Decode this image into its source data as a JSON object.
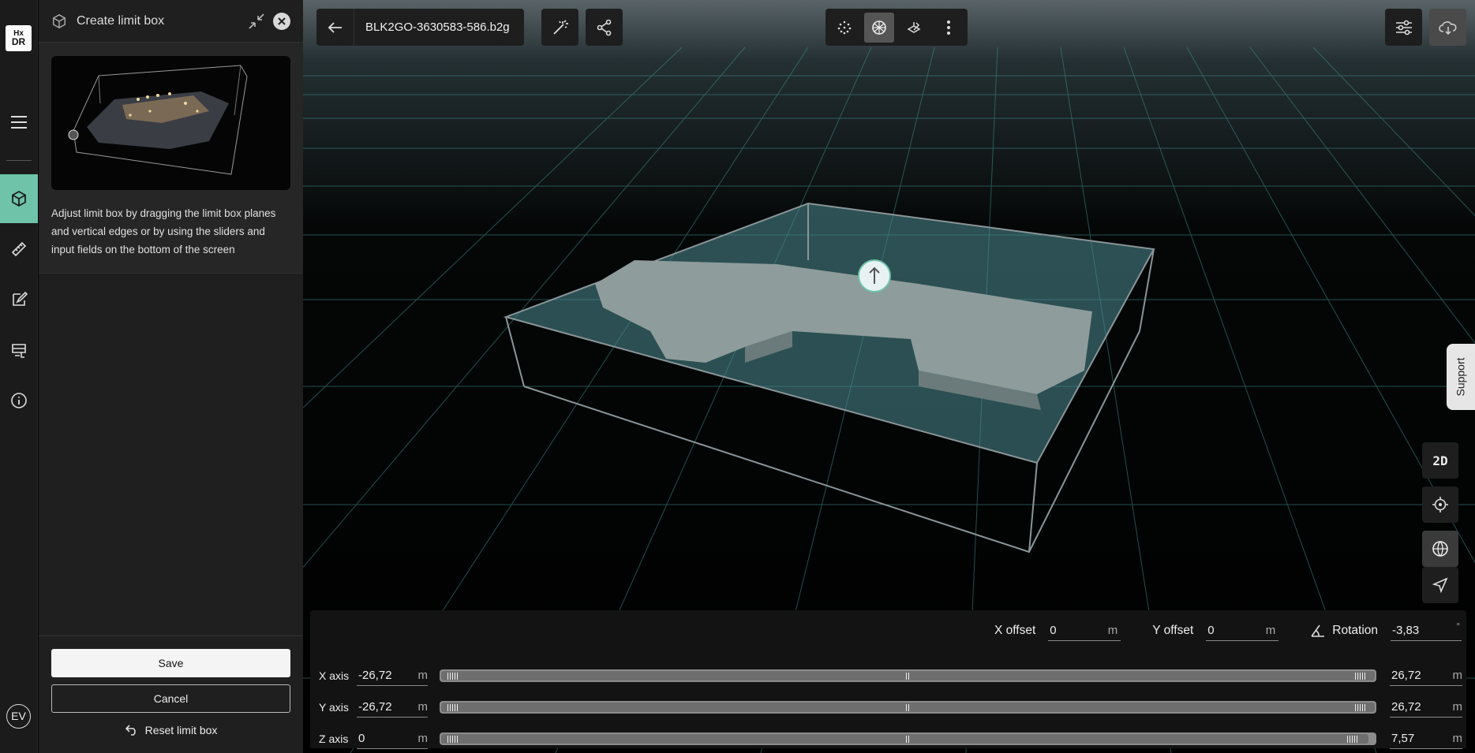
{
  "app": {
    "logo_text_top": "Hx",
    "logo_text_bottom": "DR",
    "user_initials": "EV"
  },
  "panel": {
    "title": "Create limit box",
    "description": "Adjust limit box by dragging the limit box planes and vertical edges or by using the sliders and input fields on the bottom of the screen",
    "save_label": "Save",
    "cancel_label": "Cancel",
    "reset_label": "Reset limit box"
  },
  "toolbar": {
    "file_name": "BLK2GO-3630583-586.b2g"
  },
  "view_controls": {
    "twod_label": "2D"
  },
  "support": {
    "label": "Support"
  },
  "limit_box": {
    "x_offset_label": "X offset",
    "x_offset": "0",
    "y_offset_label": "Y offset",
    "y_offset": "0",
    "rotation_label": "Rotation",
    "rotation": "-3,83",
    "rotation_unit": "°",
    "unit": "m",
    "axes": [
      {
        "label": "X axis",
        "min": "-26,72",
        "max": "26,72"
      },
      {
        "label": "Y axis",
        "min": "-26,72",
        "max": "26,72"
      },
      {
        "label": "Z axis",
        "min": "0",
        "max": "7,57"
      }
    ]
  },
  "colors": {
    "accent": "#6ec3a8",
    "panel": "#1f1f1f",
    "rail": "#1b1b1b"
  },
  "icons": [
    "hx-dr-logo",
    "menu-icon",
    "limit-box-icon",
    "measure-icon",
    "annotate-icon",
    "report-icon",
    "info-icon",
    "collapse-icon",
    "close-icon",
    "back-arrow-icon",
    "magic-wand-icon",
    "share-icon",
    "point-cloud-icon",
    "mesh-icon",
    "edit-view-icon",
    "more-vertical-icon",
    "settings-sliders-icon",
    "cloud-download-icon",
    "target-icon",
    "globe-icon",
    "navigate-icon",
    "rotation-angle-icon",
    "undo-icon"
  ]
}
